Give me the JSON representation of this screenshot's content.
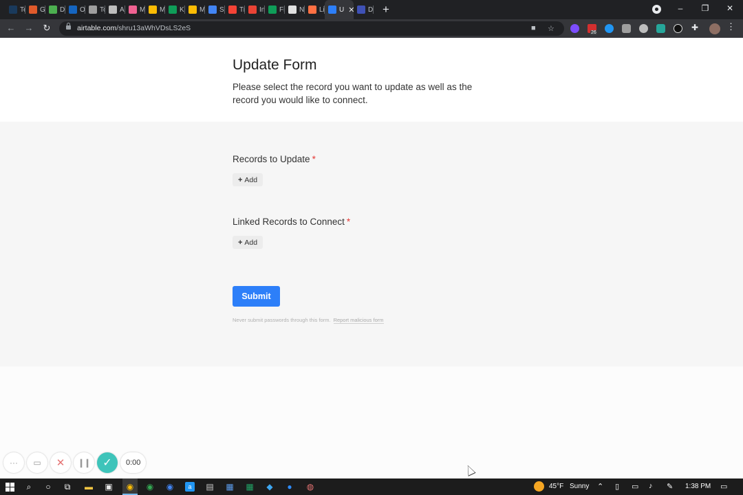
{
  "browser": {
    "tabs": [
      {
        "label": "Text",
        "color": "#1a3a5c"
      },
      {
        "label": "Gra",
        "color": "#e05a2b"
      },
      {
        "label": "Disc",
        "color": "#4caf50"
      },
      {
        "label": "Ove",
        "color": "#1565c0"
      },
      {
        "label": "Tog",
        "color": "#9e9e9e"
      },
      {
        "label": "All s",
        "color": "#bdbdbd"
      },
      {
        "label": "My",
        "color": "#f06292"
      },
      {
        "label": "My",
        "color": "#fbbc04"
      },
      {
        "label": "Kra",
        "color": "#0f9d58"
      },
      {
        "label": "My",
        "color": "#fbbc04"
      },
      {
        "label": "Sco",
        "color": "#4285f4"
      },
      {
        "label": "Trov",
        "color": "#f44336"
      },
      {
        "label": "Inbo",
        "color": "#ea4335"
      },
      {
        "label": "Fina",
        "color": "#0f9d58"
      },
      {
        "label": "New",
        "color": "#e0e0e0"
      },
      {
        "label": "Link",
        "color": "#ff7043"
      },
      {
        "label": "U",
        "color": "#2d7ff9",
        "active": true
      },
      {
        "label": "Dem",
        "color": "#3f51b5"
      }
    ],
    "new_tab": "+",
    "url_host": "airtable.com",
    "url_path": "/shru13aWhVDsLS2eS",
    "extension_badge": "26"
  },
  "form": {
    "title": "Update Form",
    "description": "Please select the record you want to update as well as the record you would like to connect.",
    "fields": [
      {
        "label": "Records to Update",
        "required_mark": "*",
        "add_label": "Add"
      },
      {
        "label": "Linked Records to Connect",
        "required_mark": "*",
        "add_label": "Add"
      }
    ],
    "submit_label": "Submit",
    "footnote": "Never submit passwords through this form.",
    "report_link": "Report malicious form"
  },
  "recorder": {
    "timer": "0:00"
  },
  "taskbar": {
    "weather_temp": "45°F",
    "weather_desc": "Sunny",
    "time": "1:38 PM"
  }
}
